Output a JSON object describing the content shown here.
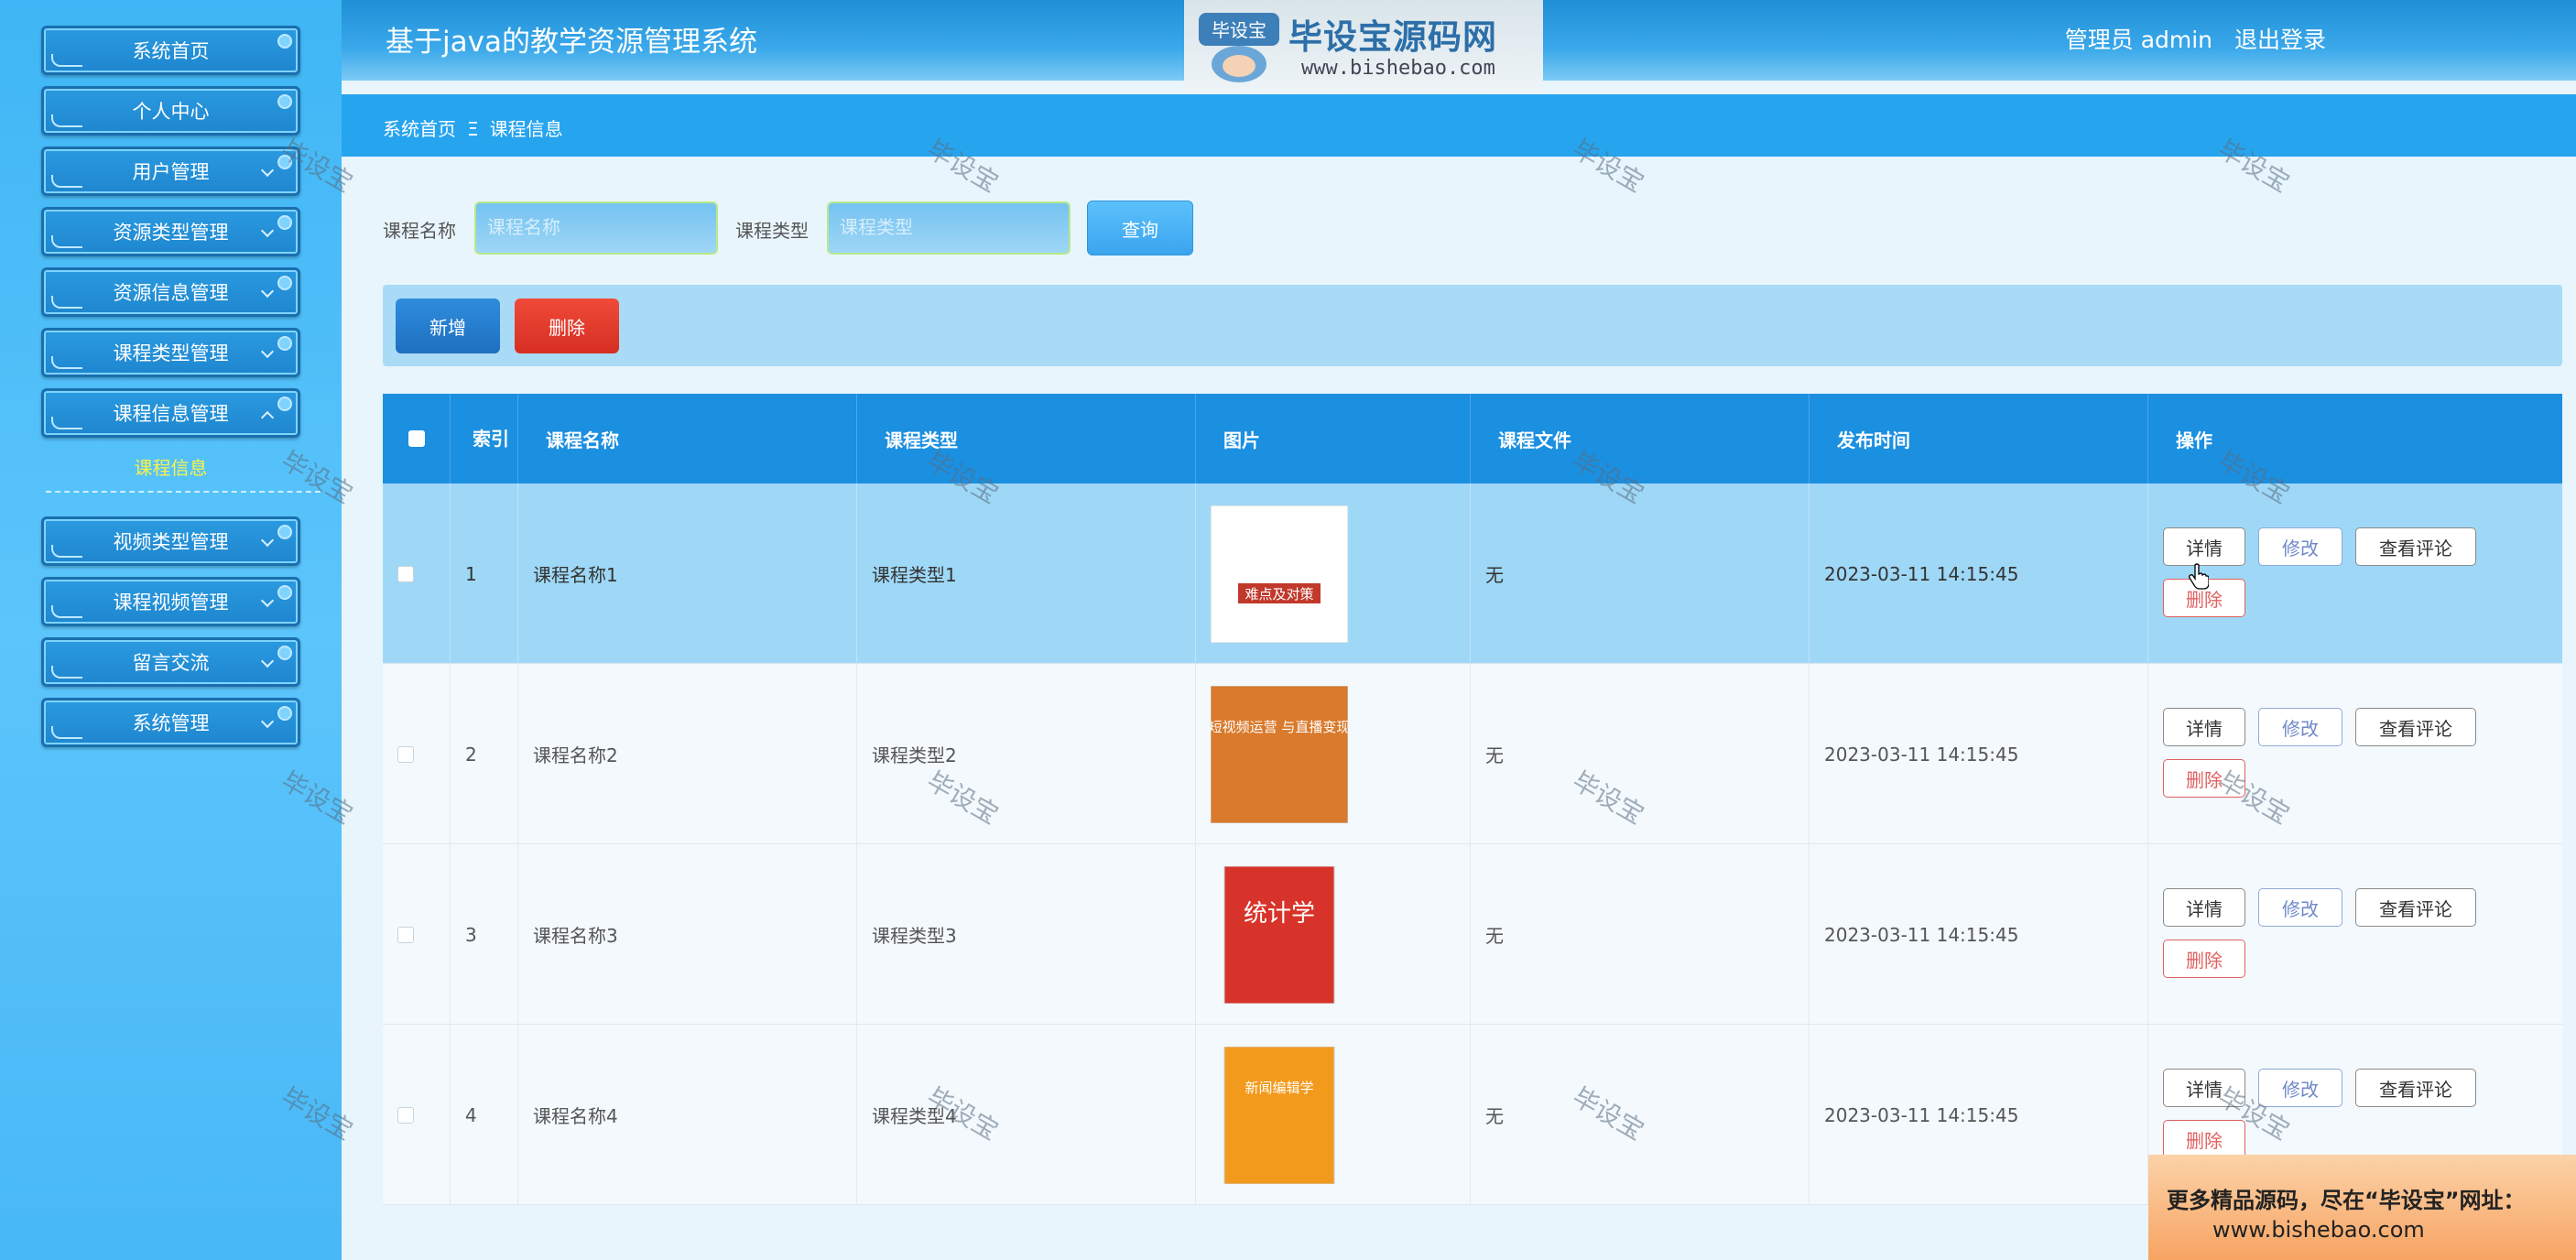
{
  "app": {
    "title": "基于java的教学资源管理系统"
  },
  "header": {
    "user_label": "管理员 admin",
    "logout_label": "退出登录"
  },
  "logo": {
    "text": "毕设宝源码网",
    "url": "www.bishebao.com",
    "badge": "毕设宝"
  },
  "sidebar": {
    "items": [
      {
        "label": "系统首页"
      },
      {
        "label": "个人中心"
      },
      {
        "label": "用户管理"
      },
      {
        "label": "资源类型管理"
      },
      {
        "label": "资源信息管理"
      },
      {
        "label": "课程类型管理"
      },
      {
        "label": "课程信息管理"
      }
    ],
    "active_sub": "课程信息",
    "items2": [
      {
        "label": "视频类型管理"
      },
      {
        "label": "课程视频管理"
      },
      {
        "label": "留言交流"
      },
      {
        "label": "系统管理"
      }
    ]
  },
  "breadcrumb": {
    "home": "系统首页",
    "sep": "Ξ",
    "current": "课程信息"
  },
  "search": {
    "name_label": "课程名称",
    "name_placeholder": "课程名称",
    "type_label": "课程类型",
    "type_placeholder": "课程类型",
    "query_label": "查询"
  },
  "actions": {
    "add_label": "新增",
    "delete_label": "删除"
  },
  "table": {
    "headers": {
      "index": "索引",
      "name": "课程名称",
      "type": "课程类型",
      "image": "图片",
      "file": "课程文件",
      "time": "发布时间",
      "ops": "操作"
    },
    "ops": {
      "detail": "详情",
      "edit": "修改",
      "review": "查看评论",
      "delete": "删除"
    },
    "rows": [
      {
        "index": "1",
        "name": "课程名称1",
        "type": "课程类型1",
        "file": "无",
        "time": "2023-03-11 14:15:45",
        "cover_text": "难点及对策",
        "cover_color": "#ffffff"
      },
      {
        "index": "2",
        "name": "课程名称2",
        "type": "课程类型2",
        "file": "无",
        "time": "2023-03-11 14:15:45",
        "cover_text": "短视频运营 与直播变现",
        "cover_color": "#d97a2c"
      },
      {
        "index": "3",
        "name": "课程名称3",
        "type": "课程类型3",
        "file": "无",
        "time": "2023-03-11 14:15:45",
        "cover_text": "统计学",
        "cover_color": "#d8332a"
      },
      {
        "index": "4",
        "name": "课程名称4",
        "type": "课程类型4",
        "file": "无",
        "time": "2023-03-11 14:15:45",
        "cover_text": "新闻编辑学",
        "cover_color": "#f29a1c"
      }
    ]
  },
  "watermark": "毕设宝",
  "promo": {
    "line1": "更多精品源码，尽在“毕设宝”网址：",
    "line2": "www.bishebao.com"
  }
}
